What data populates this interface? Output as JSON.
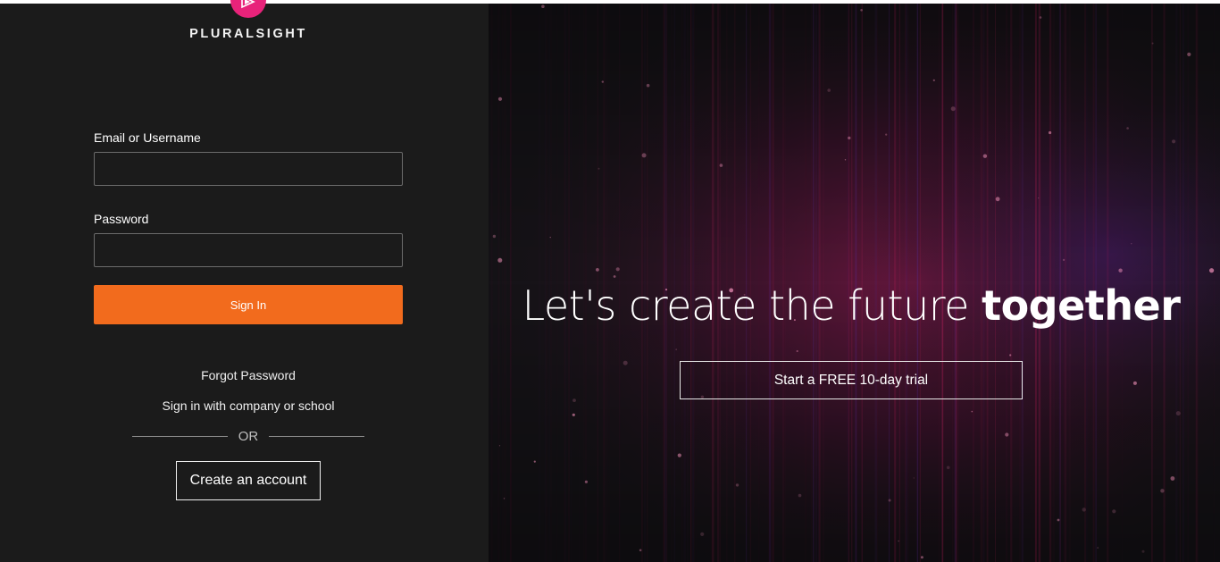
{
  "brand": {
    "logo_text": "PLURALSIGHT",
    "logo_icon": "pluralsight-play-icon",
    "accent": "#e8237a"
  },
  "form": {
    "email_label": "Email or Username",
    "email_value": "",
    "password_label": "Password",
    "password_value": "",
    "signin_label": "Sign In",
    "signin_color": "#f26b1d"
  },
  "links": {
    "forgot_password": "Forgot Password",
    "company_signin": "Sign in with company or school",
    "or_text": "OR",
    "create_account": "Create an account"
  },
  "hero": {
    "tagline_prefix": "Let's create the future ",
    "tagline_emphasis": "together",
    "trial_label": "Start a FREE 10-day trial"
  }
}
